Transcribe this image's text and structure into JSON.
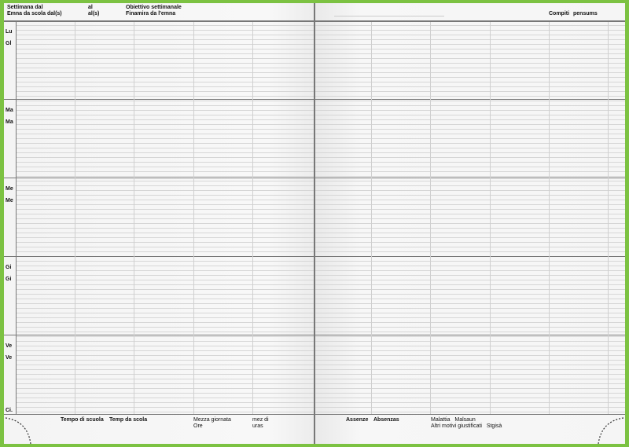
{
  "header": {
    "week_from": "Settimana dal",
    "week_from_rm": "Emna da scola dal(s)",
    "to": "al",
    "to_rm": "al(s)",
    "goal": "Obiettivo settimanale",
    "goal_rm": "Finamira da l'emna",
    "homework": "Compiti",
    "homework_rm": "pensums"
  },
  "days": [
    {
      "it": "Lu",
      "rm": "Gl"
    },
    {
      "it": "Ma",
      "rm": "Ma"
    },
    {
      "it": "Me",
      "rm": "Me"
    },
    {
      "it": "Gi",
      "rm": "Gi"
    },
    {
      "it": "Ve",
      "rm": "Ve"
    }
  ],
  "last_row_label": "Ci.",
  "footer": {
    "school_time": "Tempo di scuola",
    "school_time_rm": "Temp da scola",
    "half_day": "Mezza giornata",
    "hours": "Ore",
    "half_day_rm": "mez di",
    "hours_rm": "uras",
    "absences": "Assenze",
    "absences_rm": "Absenzas",
    "illness": "Malattia",
    "illness_rm": "Malsaun",
    "other": "Altri motivi giustificati",
    "other_rm": "Stgisà"
  },
  "colors": {
    "frame": "#7cc242",
    "paper": "#f7f7f7",
    "rule": "#d6d6d6",
    "divider": "#777777"
  }
}
